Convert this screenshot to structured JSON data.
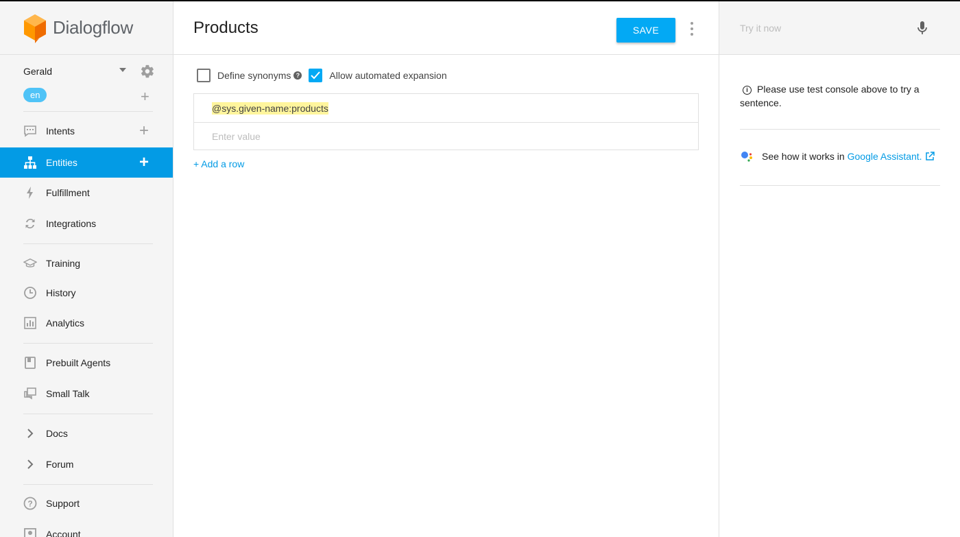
{
  "app": {
    "name": "Dialogflow"
  },
  "agent": {
    "name": "Gerald",
    "language": "en"
  },
  "nav": {
    "intents": "Intents",
    "entities": "Entities",
    "fulfillment": "Fulfillment",
    "integrations": "Integrations",
    "training": "Training",
    "history": "History",
    "analytics": "Analytics",
    "prebuilt": "Prebuilt Agents",
    "smalltalk": "Small Talk",
    "docs": "Docs",
    "forum": "Forum",
    "support": "Support",
    "account": "Account"
  },
  "page": {
    "title": "Products",
    "save_label": "SAVE",
    "define_synonyms": {
      "label": "Define synonyms",
      "checked": false
    },
    "auto_expansion": {
      "label": "Allow automated expansion",
      "checked": true
    },
    "entries": [
      {
        "value": "@sys.given-name:products"
      }
    ],
    "entry_placeholder": "Enter value",
    "add_row_label": "+ Add a row"
  },
  "console": {
    "placeholder": "Try it now",
    "info_text": "Please use test console above to try a sentence.",
    "ga_prefix": "See how it works in",
    "ga_link": "Google Assistant."
  },
  "colors": {
    "accent": "#039be5",
    "save": "#03a9f4",
    "highlight": "#fff59d",
    "logo": "#ff9800"
  }
}
